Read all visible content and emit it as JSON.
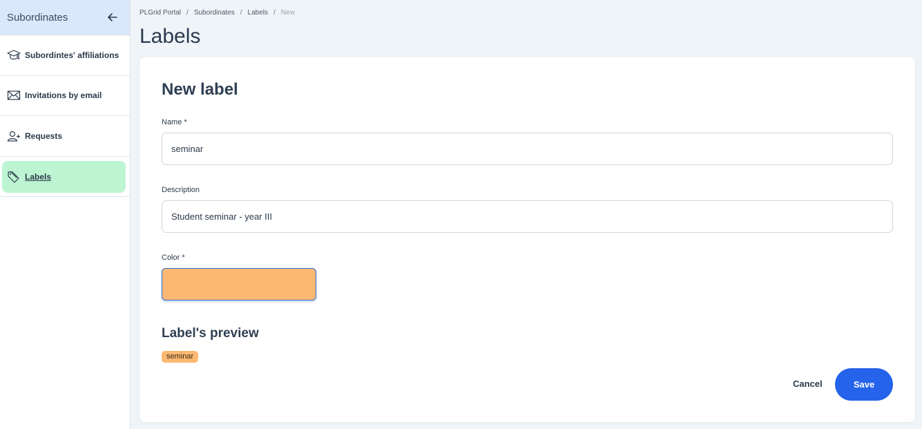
{
  "sidebar": {
    "title": "Subordinates",
    "back_icon": "arrow-left-icon",
    "items": [
      {
        "label": "Subordintes' affiliations",
        "icon": "graduation-cap-icon"
      },
      {
        "label": "Invitations by email",
        "icon": "envelope-icon"
      },
      {
        "label": "Requests",
        "icon": "user-plus-icon"
      },
      {
        "label": "Labels",
        "icon": "tag-icon",
        "active": true
      }
    ]
  },
  "breadcrumb": {
    "items": [
      "PLGrid Portal",
      "Subordinates",
      "Labels"
    ],
    "current": "New",
    "separator": "/"
  },
  "page": {
    "title": "Labels"
  },
  "form": {
    "title": "New label",
    "name_label": "Name *",
    "name_value": "seminar",
    "description_label": "Description",
    "description_value": "Student seminar - year III",
    "color_label": "Color *",
    "color_value": "#fdb872",
    "preview_title": "Label's preview",
    "preview_text": "seminar",
    "cancel_label": "Cancel",
    "save_label": "Save"
  },
  "colors": {
    "accent": "#2563eb",
    "active_nav": "#bdf5d3",
    "sidebar_header": "#dbe8fb"
  }
}
